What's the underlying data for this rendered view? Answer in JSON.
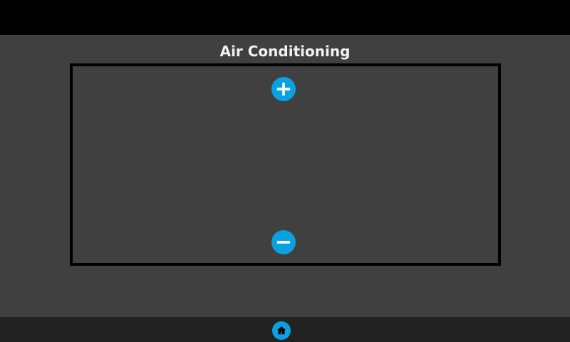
{
  "screen": {
    "title": "Air Conditioning"
  },
  "controls": {
    "increase_icon": "plus-icon",
    "decrease_icon": "minus-icon"
  },
  "navigation": {
    "home_icon": "home-icon"
  },
  "colors": {
    "accent": "#0aa1e2",
    "background": "#404040",
    "top_bar": "#000000",
    "bottom_bar": "#222222",
    "title_text": "#f2f2f2"
  }
}
